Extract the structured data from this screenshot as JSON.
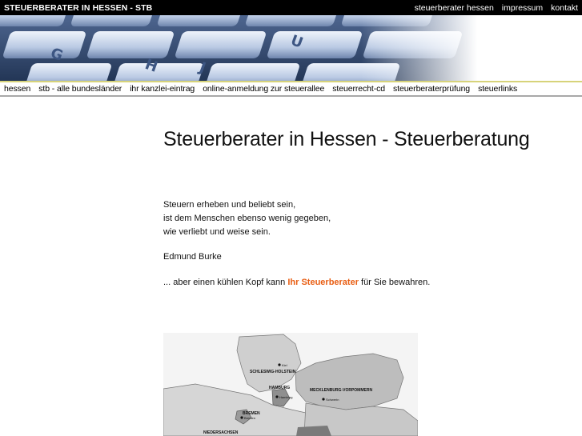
{
  "header": {
    "site_title": "STEUERBERATER IN HESSEN - STB",
    "links": [
      "steuerberater hessen",
      "impressum",
      "kontakt"
    ]
  },
  "banner": {
    "key_letters": [
      "G",
      "H",
      "J",
      "U"
    ]
  },
  "nav": {
    "items": [
      "hessen",
      "stb - alle bundesländer",
      "ihr kanzlei-eintrag",
      "online-anmeldung zur steuerallee",
      "steuerrecht-cd",
      "steuerberaterprüfung",
      "steuerlinks"
    ]
  },
  "main": {
    "title": "Steuerberater in Hessen - Steuerberatung",
    "quote_lines": [
      "Steuern erheben und beliebt sein,",
      "ist dem Menschen ebenso wenig gegeben,",
      "wie verliebt und weise sein."
    ],
    "author": "Edmund Burke",
    "tagline_before": "... aber einen kühlen Kopf kann ",
    "tagline_link": "Ihr Steuerberater",
    "tagline_after": " für Sie bewahren."
  },
  "map": {
    "regions": [
      "SCHLESWIG-HOLSTEIN",
      "HAMBURG",
      "MECKLENBURG-VORPOMMERN",
      "BREMEN",
      "NIEDERSACHSEN"
    ],
    "cities": [
      "Kiel",
      "Hamburg",
      "Schwerin",
      "Bremen"
    ]
  },
  "colors": {
    "accent": "#e85d12",
    "topbar": "#000000",
    "nav_border_top": "#d7d37a"
  }
}
